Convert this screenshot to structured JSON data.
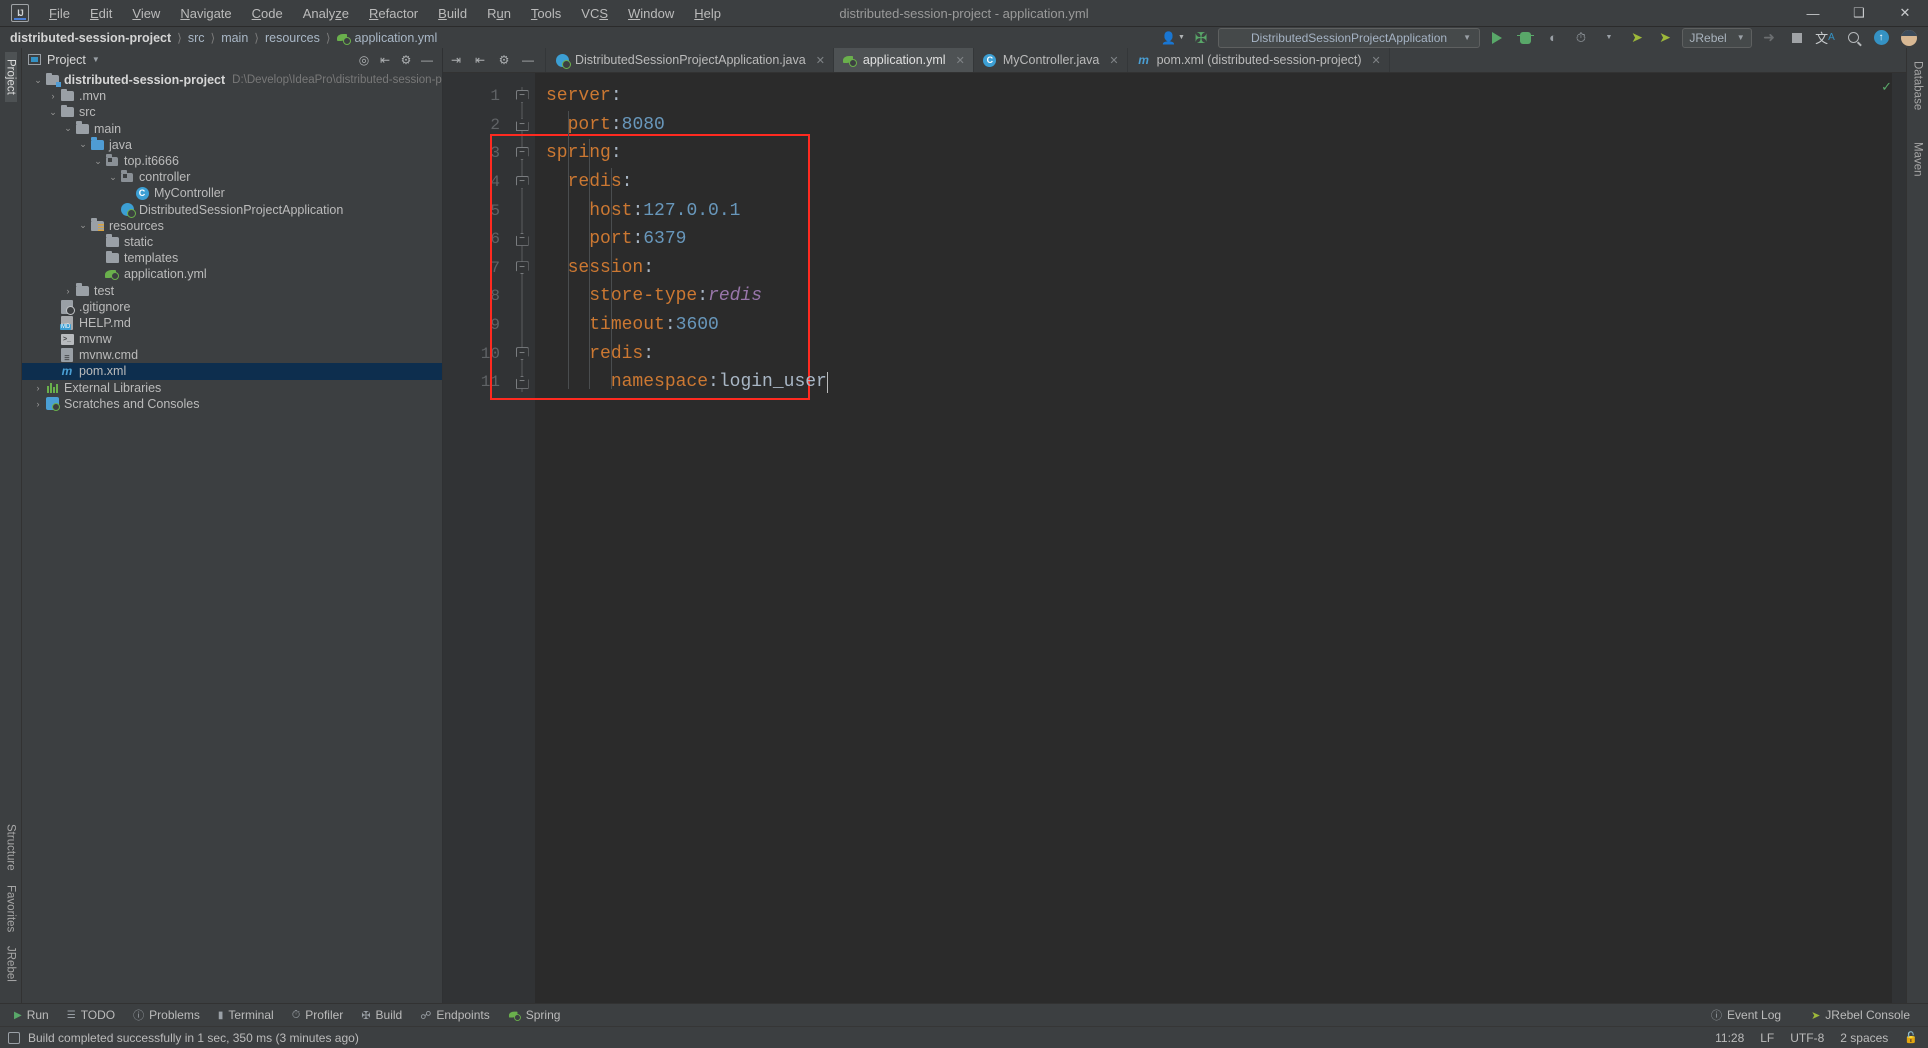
{
  "window": {
    "title": "distributed-session-project - application.yml",
    "app_icon": "IJ",
    "minimize": "—",
    "maximize": "❑",
    "close": "✕"
  },
  "menubar": {
    "items": [
      "File",
      "Edit",
      "View",
      "Navigate",
      "Code",
      "Analyze",
      "Refactor",
      "Build",
      "Run",
      "Tools",
      "VCS",
      "Window",
      "Help"
    ]
  },
  "navbar": {
    "crumbs": [
      "distributed-session-project",
      "src",
      "main",
      "resources",
      "application.yml"
    ],
    "separator": "〉"
  },
  "toolbar": {
    "run_config": "DistributedSessionProjectApplication",
    "run_config_caret": "▼",
    "jrebel_label": "JRebel",
    "jrebel_caret": "▼",
    "icons": [
      "user-icon",
      "build-hammer-icon",
      "run-icon",
      "debug-icon",
      "run-coverage-icon",
      "profiler-icon",
      "jrebel-run-icon",
      "jrebel-debug-icon",
      "update-app-icon",
      "stop-icon",
      "translate-icon",
      "search-everywhere-icon",
      "updates-icon",
      "account-avatar"
    ]
  },
  "project_panel": {
    "title": "Project",
    "title_caret": "▼",
    "header_icons": [
      "locate-icon",
      "collapse-all-icon",
      "settings-gear-icon",
      "hide-icon"
    ],
    "tree": [
      {
        "depth": 0,
        "arrow": "⌄",
        "icon": "project-folder-icon",
        "label": "distributed-session-project",
        "bold": true,
        "path": "D:\\Develop\\IdeaPro\\distributed-session-project",
        "selected": false
      },
      {
        "depth": 1,
        "arrow": "›",
        "icon": "folder-icon",
        "label": ".mvn",
        "bold": false,
        "path": "",
        "selected": false
      },
      {
        "depth": 1,
        "arrow": "⌄",
        "icon": "folder-icon",
        "label": "src",
        "bold": false,
        "path": "",
        "selected": false
      },
      {
        "depth": 2,
        "arrow": "⌄",
        "icon": "folder-icon",
        "label": "main",
        "bold": false,
        "path": "",
        "selected": false
      },
      {
        "depth": 3,
        "arrow": "⌄",
        "icon": "source-folder-icon",
        "label": "java",
        "bold": false,
        "path": "",
        "selected": false
      },
      {
        "depth": 4,
        "arrow": "⌄",
        "icon": "package-icon",
        "label": "top.it6666",
        "bold": false,
        "path": "",
        "selected": false
      },
      {
        "depth": 5,
        "arrow": "⌄",
        "icon": "package-icon",
        "label": "controller",
        "bold": false,
        "path": "",
        "selected": false
      },
      {
        "depth": 6,
        "arrow": "",
        "icon": "java-class-icon",
        "label": "MyController",
        "bold": false,
        "path": "",
        "selected": false
      },
      {
        "depth": 5,
        "arrow": "",
        "icon": "spring-boot-class-icon",
        "label": "DistributedSessionProjectApplication",
        "bold": false,
        "path": "",
        "selected": false
      },
      {
        "depth": 3,
        "arrow": "⌄",
        "icon": "resources-folder-icon",
        "label": "resources",
        "bold": false,
        "path": "",
        "selected": false
      },
      {
        "depth": 4,
        "arrow": "",
        "icon": "folder-icon",
        "label": "static",
        "bold": false,
        "path": "",
        "selected": false
      },
      {
        "depth": 4,
        "arrow": "",
        "icon": "folder-icon",
        "label": "templates",
        "bold": false,
        "path": "",
        "selected": false
      },
      {
        "depth": 4,
        "arrow": "",
        "icon": "spring-yaml-icon",
        "label": "application.yml",
        "bold": false,
        "path": "",
        "selected": false
      },
      {
        "depth": 2,
        "arrow": "›",
        "icon": "folder-icon",
        "label": "test",
        "bold": false,
        "path": "",
        "selected": false
      },
      {
        "depth": 1,
        "arrow": "",
        "icon": "gitignore-icon",
        "label": ".gitignore",
        "bold": false,
        "path": "",
        "selected": false
      },
      {
        "depth": 1,
        "arrow": "",
        "icon": "markdown-icon",
        "label": "HELP.md",
        "bold": false,
        "path": "",
        "selected": false
      },
      {
        "depth": 1,
        "arrow": "",
        "icon": "shell-script-icon",
        "label": "mvnw",
        "bold": false,
        "path": "",
        "selected": false
      },
      {
        "depth": 1,
        "arrow": "",
        "icon": "cmd-script-icon",
        "label": "mvnw.cmd",
        "bold": false,
        "path": "",
        "selected": false
      },
      {
        "depth": 1,
        "arrow": "",
        "icon": "maven-pom-icon",
        "label": "pom.xml",
        "bold": false,
        "path": "",
        "selected": true
      },
      {
        "depth": 0,
        "arrow": "›",
        "icon": "external-libraries-icon",
        "label": "External Libraries",
        "bold": false,
        "path": "",
        "selected": false
      },
      {
        "depth": 0,
        "arrow": "›",
        "icon": "scratches-icon",
        "label": "Scratches and Consoles",
        "bold": false,
        "path": "",
        "selected": false
      }
    ]
  },
  "left_strip": {
    "top": [
      "Project"
    ],
    "bottom": [
      "Structure",
      "Favorites",
      "JRebel"
    ]
  },
  "right_strip": {
    "items": [
      "Database",
      "Maven"
    ]
  },
  "editor_tabs": [
    {
      "label": "DistributedSessionProjectApplication.java",
      "icon": "spring-boot-class-icon",
      "active": false,
      "close": "✕"
    },
    {
      "label": "application.yml",
      "icon": "spring-yaml-icon",
      "active": true,
      "close": "✕"
    },
    {
      "label": "MyController.java",
      "icon": "java-class-icon",
      "active": false,
      "close": "✕"
    },
    {
      "label": "pom.xml (distributed-session-project)",
      "icon": "maven-pom-icon",
      "active": false,
      "close": "✕"
    }
  ],
  "editor": {
    "filename": "application.yml",
    "inspection_status": "✓",
    "highlight_box_color": "#ff2a20",
    "caret_line": 11,
    "line_numbers": [
      "1",
      "2",
      "3",
      "4",
      "5",
      "6",
      "7",
      "8",
      "9",
      "10",
      "11"
    ],
    "lines": [
      {
        "n": 1,
        "indent": 0,
        "key": "server",
        "sep": ":",
        "value": "",
        "value_type": "none",
        "fold": "top"
      },
      {
        "n": 2,
        "indent": 1,
        "key": "port",
        "sep": ":",
        "value": "8080",
        "value_type": "number",
        "fold": "bottom"
      },
      {
        "n": 3,
        "indent": 0,
        "key": "spring",
        "sep": ":",
        "value": "",
        "value_type": "none",
        "fold": "top"
      },
      {
        "n": 4,
        "indent": 1,
        "key": "redis",
        "sep": ":",
        "value": "",
        "value_type": "none",
        "fold": "top"
      },
      {
        "n": 5,
        "indent": 2,
        "key": "host",
        "sep": ":",
        "value": "127.0.0.1",
        "value_type": "number",
        "fold": "none"
      },
      {
        "n": 6,
        "indent": 2,
        "key": "port",
        "sep": ":",
        "value": "6379",
        "value_type": "number",
        "fold": "bottom"
      },
      {
        "n": 7,
        "indent": 1,
        "key": "session",
        "sep": ":",
        "value": "",
        "value_type": "none",
        "fold": "top"
      },
      {
        "n": 8,
        "indent": 2,
        "key": "store-type",
        "sep": ":",
        "value": "redis",
        "value_type": "enum",
        "fold": "none"
      },
      {
        "n": 9,
        "indent": 2,
        "key": "timeout",
        "sep": ":",
        "value": "3600",
        "value_type": "number",
        "fold": "none"
      },
      {
        "n": 10,
        "indent": 2,
        "key": "redis",
        "sep": ":",
        "value": "",
        "value_type": "none",
        "fold": "top"
      },
      {
        "n": 11,
        "indent": 3,
        "key": "namespace",
        "sep": ":",
        "value": "login_user",
        "value_type": "plain",
        "fold": "bottom"
      }
    ],
    "syntax_colors": {
      "key": "#cc7832",
      "number": "#6897bb",
      "enum": "#9876aa",
      "plain": "#a9b7c6",
      "background": "#2b2b2b",
      "gutter": "#313335"
    }
  },
  "bottom_bar": {
    "items": [
      {
        "label": "Run",
        "icon": "run-icon"
      },
      {
        "label": "TODO",
        "icon": "todo-icon"
      },
      {
        "label": "Problems",
        "icon": "problems-icon"
      },
      {
        "label": "Terminal",
        "icon": "terminal-icon"
      },
      {
        "label": "Profiler",
        "icon": "profiler-icon"
      },
      {
        "label": "Build",
        "icon": "build-hammer-icon"
      },
      {
        "label": "Endpoints",
        "icon": "endpoints-icon"
      },
      {
        "label": "Spring",
        "icon": "spring-leaf-icon"
      }
    ],
    "right": [
      {
        "label": "Event Log",
        "icon": "event-log-icon"
      },
      {
        "label": "JRebel Console",
        "icon": "jrebel-icon"
      }
    ]
  },
  "status_bar": {
    "message": "Build completed successfully in 1 sec, 350 ms (3 minutes ago)",
    "message_icon": "build-status-icon",
    "time": "11:28",
    "line_separator": "LF",
    "encoding": "UTF-8",
    "indent": "2 spaces",
    "lock_icon": "write-access-icon"
  }
}
